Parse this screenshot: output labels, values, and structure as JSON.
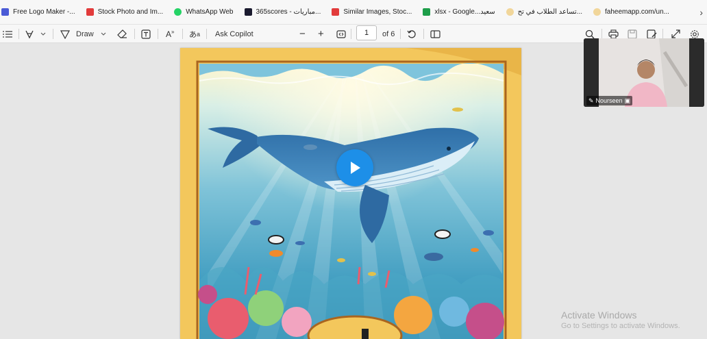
{
  "bookmarks": {
    "items": [
      {
        "label": "Free Logo Maker -...",
        "color": "#4b5bd6"
      },
      {
        "label": "Stock Photo and Im...",
        "color": "#e23b3b"
      },
      {
        "label": "WhatsApp Web",
        "color": "#25d366"
      },
      {
        "label": "365scores - مباريات...",
        "color": "#1a1a2e"
      },
      {
        "label": "Similar Images, Stoc...",
        "color": "#e23b3b"
      },
      {
        "label": "xlsx - Google...سعيد",
        "color": "#1e9e4a"
      },
      {
        "label": "تساعد الطلاب في تح...",
        "color": "#f1d69a"
      },
      {
        "label": "faheemapp.com/un...",
        "color": "#f1d69a"
      }
    ],
    "more_icon": "chevron-right-icon"
  },
  "toolbar": {
    "draw_label": "Draw",
    "ask_copilot_label": "Ask Copilot",
    "page_number": "1",
    "page_total_label": "of 6"
  },
  "video": {
    "participant_name": "Nourseen"
  },
  "watermark": {
    "title": "Activate Windows",
    "subtitle": "Go to Settings to activate Windows."
  },
  "colors": {
    "page_border": "#f3c75c",
    "play_button": "#1d8fe8",
    "frame": "#a9651f"
  }
}
